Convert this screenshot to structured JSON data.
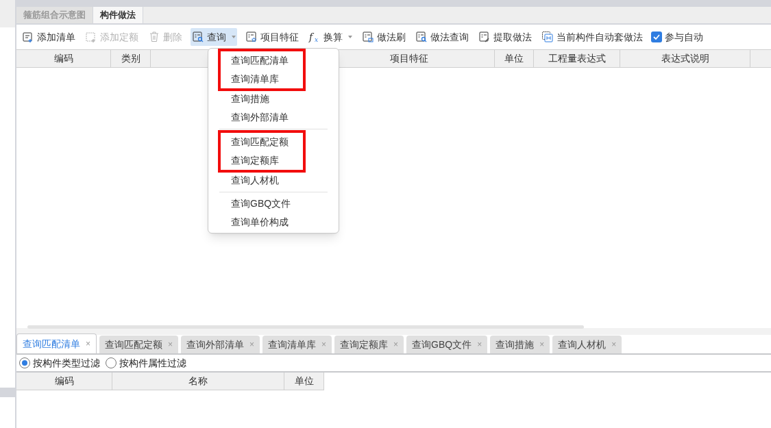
{
  "panel_tabs": [
    {
      "label": "箍筋组合示意图",
      "selected": false
    },
    {
      "label": "构件做法",
      "selected": true
    }
  ],
  "toolbar": [
    {
      "kind": "list-add",
      "label": "添加清单",
      "disabled": false,
      "caret": false,
      "active": false
    },
    {
      "kind": "grid-add",
      "label": "添加定额",
      "disabled": true,
      "caret": false,
      "active": false
    },
    {
      "kind": "trash",
      "label": "删除",
      "disabled": true,
      "caret": false,
      "active": false
    },
    {
      "kind": "list-search",
      "label": "查询",
      "disabled": false,
      "caret": true,
      "active": true
    },
    {
      "kind": "list-star",
      "label": "项目特征",
      "disabled": false,
      "caret": false,
      "active": false
    },
    {
      "kind": "fx",
      "label": "换算",
      "disabled": false,
      "caret": true,
      "active": false
    },
    {
      "kind": "list-brush",
      "label": "做法刷",
      "disabled": false,
      "caret": false,
      "active": false
    },
    {
      "kind": "list-search",
      "label": "做法查询",
      "disabled": false,
      "caret": false,
      "active": false
    },
    {
      "kind": "list-pick",
      "label": "提取做法",
      "disabled": false,
      "caret": false,
      "active": false
    },
    {
      "kind": "h-box",
      "label": "当前构件自动套做法",
      "disabled": false,
      "caret": false,
      "active": false
    }
  ],
  "toolbar_checkbox": {
    "label": "参与自动",
    "checked": true
  },
  "table": {
    "columns": [
      "编码",
      "类别",
      "",
      "项目特征",
      "单位",
      "工程量表达式",
      "表达式说明"
    ]
  },
  "dropdown_menu": {
    "sections": [
      {
        "blocks": [
          {
            "highlighted": true,
            "items": [
              "查询匹配清单",
              "查询清单库"
            ]
          },
          {
            "highlighted": false,
            "items": [
              "查询措施",
              "查询外部清单"
            ]
          }
        ]
      },
      {
        "blocks": [
          {
            "highlighted": true,
            "items": [
              "查询匹配定额",
              "查询定额库"
            ]
          },
          {
            "highlighted": false,
            "items": [
              "查询人材机"
            ]
          }
        ]
      },
      {
        "blocks": [
          {
            "highlighted": false,
            "items": [
              "查询GBQ文件",
              "查询单价构成"
            ]
          }
        ]
      }
    ]
  },
  "bottom_tabs": [
    {
      "label": "查询匹配清单",
      "close": "×",
      "selected": true
    },
    {
      "label": "查询匹配定额",
      "close": "×",
      "selected": false
    },
    {
      "label": "查询外部清单",
      "close": "×",
      "selected": false
    },
    {
      "label": "查询清单库",
      "close": "×",
      "selected": false
    },
    {
      "label": "查询定额库",
      "close": "×",
      "selected": false
    },
    {
      "label": "查询GBQ文件",
      "close": "×",
      "selected": false
    },
    {
      "label": "查询措施",
      "close": "×",
      "selected": false
    },
    {
      "label": "查询人材机",
      "close": "×",
      "selected": false
    }
  ],
  "filters": [
    {
      "label": "按构件类型过滤",
      "selected": true
    },
    {
      "label": "按构件属性过滤",
      "selected": false
    }
  ],
  "bottom_table": {
    "columns": [
      "编码",
      "名称",
      "单位"
    ]
  }
}
